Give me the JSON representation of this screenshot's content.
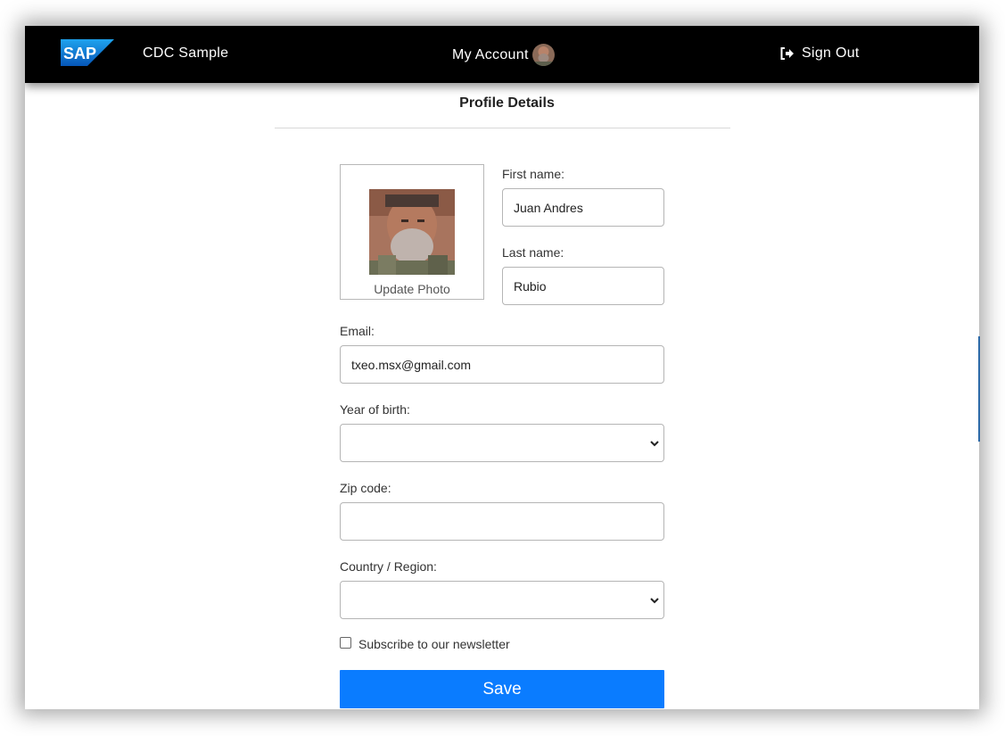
{
  "header": {
    "brand_name": "CDC Sample",
    "logo_text": "SAP",
    "account_label": "My Account",
    "signout_label": "Sign Out"
  },
  "page": {
    "title": "Profile Details"
  },
  "photo": {
    "update_label": "Update Photo"
  },
  "form": {
    "first_name_label": "First name:",
    "first_name_value": "Juan Andres",
    "last_name_label": "Last name:",
    "last_name_value": "Rubio",
    "email_label": "Email:",
    "email_value": "txeo.msx@gmail.com",
    "year_label": "Year of birth:",
    "year_value": "",
    "zip_label": "Zip code:",
    "zip_value": "",
    "country_label": "Country / Region:",
    "country_value": "",
    "newsletter_label": "Subscribe to our newsletter",
    "newsletter_checked": false,
    "save_label": "Save"
  },
  "colors": {
    "navbar_bg": "#000000",
    "primary_button": "#0a7cff",
    "sap_logo_blue": "#0a6ed1"
  },
  "icons": {
    "logo": "sap-logo",
    "avatar": "avatar-photo",
    "signout": "sign-out-icon",
    "select_caret": "chevron-down-icon"
  }
}
